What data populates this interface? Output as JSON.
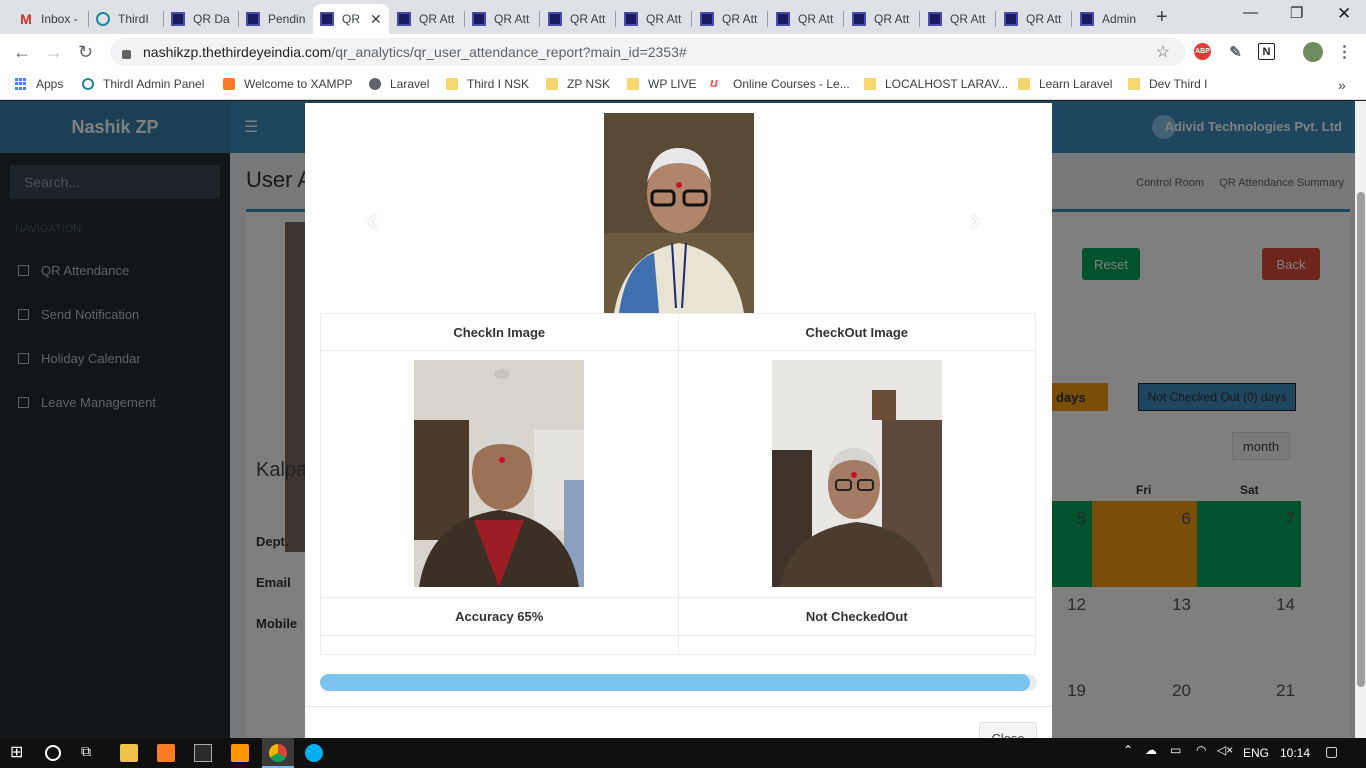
{
  "browser": {
    "tabs": [
      {
        "label": "Inbox -",
        "icon": "gmail-icon"
      },
      {
        "label": "ThirdI",
        "icon": "thirdi-icon"
      },
      {
        "label": "QR Da",
        "icon": "qr-icon"
      },
      {
        "label": "Pendin",
        "icon": "qr-icon"
      },
      {
        "label": "QR",
        "icon": "qr-icon",
        "active": true
      },
      {
        "label": "QR Att",
        "icon": "qr-icon"
      },
      {
        "label": "QR Att",
        "icon": "qr-icon"
      },
      {
        "label": "QR Att",
        "icon": "qr-icon"
      },
      {
        "label": "QR Att",
        "icon": "qr-icon"
      },
      {
        "label": "QR Att",
        "icon": "qr-icon"
      },
      {
        "label": "QR Att",
        "icon": "qr-icon"
      },
      {
        "label": "QR Att",
        "icon": "qr-icon"
      },
      {
        "label": "QR Att",
        "icon": "qr-icon"
      },
      {
        "label": "QR Att",
        "icon": "qr-icon"
      },
      {
        "label": "Admin",
        "icon": "qr-icon"
      }
    ],
    "url_host": "nashikzp.thethirdeyeindia.com",
    "url_path": "/qr_analytics/qr_user_attendance_report?main_id=2353#",
    "bookmarks": [
      {
        "label": "Apps",
        "icon": "apps-grid-icon"
      },
      {
        "label": "ThirdI Admin Panel",
        "icon": "thirdi-icon"
      },
      {
        "label": "Welcome to XAMPP",
        "icon": "xampp-icon"
      },
      {
        "label": "Laravel",
        "icon": "globe-icon"
      },
      {
        "label": "Third I NSK",
        "icon": "folder-icon"
      },
      {
        "label": "ZP NSK",
        "icon": "folder-icon"
      },
      {
        "label": "WP LIVE",
        "icon": "folder-icon"
      },
      {
        "label": "Online Courses - Le...",
        "icon": "udemy-icon"
      },
      {
        "label": "LOCALHOST LARAV...",
        "icon": "folder-icon"
      },
      {
        "label": "Learn Laravel",
        "icon": "folder-icon"
      },
      {
        "label": "Dev Third I",
        "icon": "folder-icon"
      }
    ],
    "extensions": {
      "abp": "ABP",
      "n": "N"
    }
  },
  "app": {
    "brand": "Nashik ZP",
    "company": "Adivid Technologies Pvt. Ltd",
    "search_placeholder": "Search...",
    "nav_label": "NAVIGATION",
    "menu": [
      "QR Attendance",
      "Send Notification",
      "Holiday Calendar",
      "Leave Management"
    ],
    "page_title": "User A",
    "breadcrumb": [
      "Control Room",
      "QR Attendance Summary"
    ],
    "reset_label": "Reset",
    "back_label": "Back",
    "days_badge": "days",
    "not_checked_out_badge": "Not Checked Out (0) days",
    "month_button": "month",
    "profile_name": "Kalpa",
    "profile_fields": [
      "Dept.",
      "Email",
      "Mobile"
    ],
    "day_headers": [
      "Fri",
      "Sat"
    ],
    "calendar_days": [
      "5",
      "6",
      "7",
      "12",
      "13",
      "14",
      "19",
      "20",
      "21"
    ]
  },
  "modal": {
    "checkin_header": "CheckIn Image",
    "checkout_header": "CheckOut Image",
    "accuracy": "Accuracy 65%",
    "checkout_status": "Not CheckedOut",
    "progress": 0.99,
    "close_label": "Close"
  },
  "taskbar": {
    "language": "ENG",
    "time": "10:14"
  },
  "colors": {
    "accent": "#3c8dbc",
    "progress": "#7cc4f0",
    "reset": "#00a65a",
    "back": "#dd4b39"
  }
}
